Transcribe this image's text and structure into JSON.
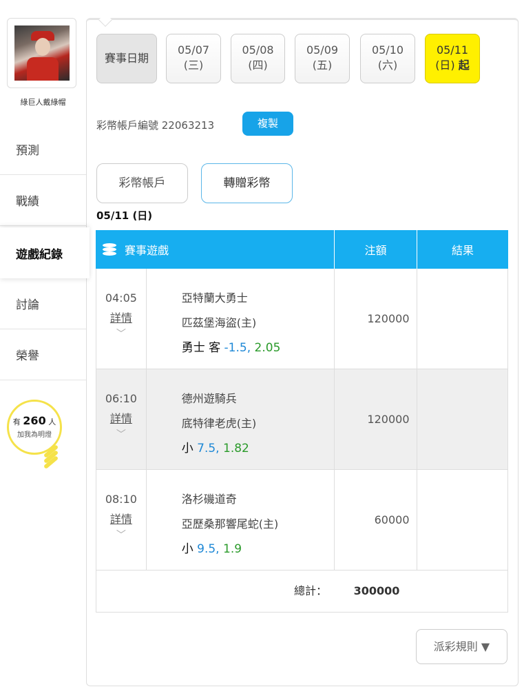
{
  "sidebar": {
    "nickname": "綠巨人戴綠帽",
    "items": [
      {
        "label": "預測"
      },
      {
        "label": "戰績"
      },
      {
        "label": "遊戲紀錄"
      },
      {
        "label": "討論"
      },
      {
        "label": "榮譽"
      }
    ],
    "fans": {
      "prefix": "有",
      "count": "260",
      "suffix": "人",
      "caption": "加我為明燈"
    }
  },
  "dates": {
    "label": "賽事日期",
    "items": [
      {
        "date": "05/07",
        "weekday": "(三)"
      },
      {
        "date": "05/08",
        "weekday": "(四)"
      },
      {
        "date": "05/09",
        "weekday": "(五)"
      },
      {
        "date": "05/10",
        "weekday": "(六)"
      },
      {
        "date": "05/11",
        "weekday": "(日)",
        "suffix": "起"
      }
    ]
  },
  "account": {
    "text": "彩幣帳戶編號 22063213",
    "copy_label": "複製"
  },
  "tabs": [
    {
      "label": "彩幣帳戶"
    },
    {
      "label": "轉贈彩幣"
    }
  ],
  "date_heading": "05/11 (日)",
  "table": {
    "headers": {
      "game": "賽事遊戲",
      "amount": "注額",
      "result": "結果"
    },
    "rows": [
      {
        "time": "04:05",
        "detail": "詳情",
        "away": "亞特蘭大勇士",
        "home": "匹茲堡海盜(主)",
        "pick": "勇士 客",
        "odd1": "-1.5,",
        "odd2": "2.05",
        "amount": "120000",
        "result": ""
      },
      {
        "time": "06:10",
        "detail": "詳情",
        "away": "德州遊騎兵",
        "home": "底特律老虎(主)",
        "pick": "小",
        "odd1": "7.5,",
        "odd2": "1.82",
        "amount": "120000",
        "result": ""
      },
      {
        "time": "08:10",
        "detail": "詳情",
        "away": "洛杉磯道奇",
        "home": "亞歷桑那響尾蛇(主)",
        "pick": "小",
        "odd1": "9.5,",
        "odd2": "1.9",
        "amount": "60000",
        "result": ""
      }
    ],
    "total_label": "總計：",
    "total_value": "300000"
  },
  "rules_label": "派彩規則 ▼"
}
